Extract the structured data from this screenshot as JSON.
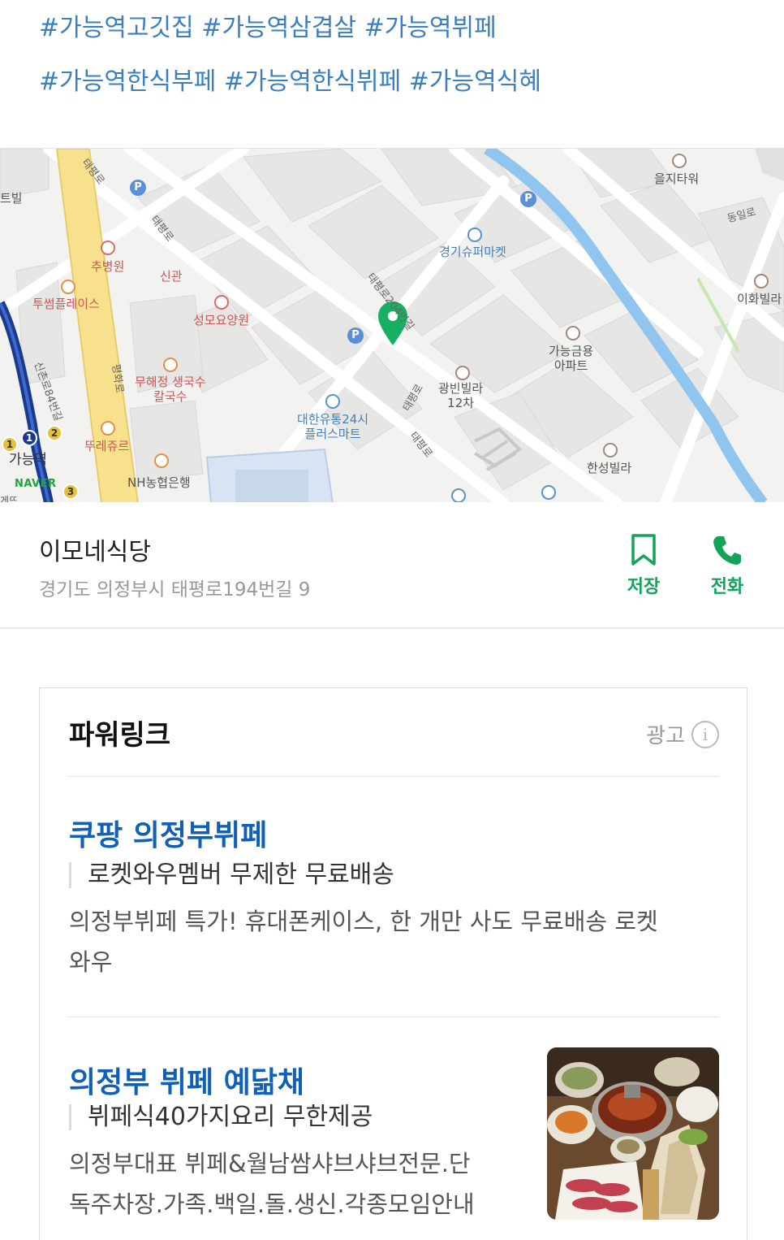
{
  "hashtags": {
    "line1": [
      "#가능역고깃집",
      "#가능역삼겹살",
      "#가능역뷔페"
    ],
    "line2": [
      "#가능역한식부페",
      "#가능역한식뷔페",
      "#가능역식혜"
    ]
  },
  "map": {
    "labels": {
      "euljitower": "을지타워",
      "dongilro": "동일로",
      "ihwavilla": "이화빌라",
      "gyeonggisuper": "경기슈퍼마켓",
      "gageumyong": "가능금용\n아파트",
      "gwangbinvilla": "광빈빌라\n12차",
      "hansungvilla": "한성빌라",
      "daehan24": "대한유통24시\n플러스마트",
      "taepyeong204": "태평로204번길",
      "taepyeongro_a": "태평로",
      "taepyeongro_b": "태평로",
      "taepyeongro_c": "태평로",
      "taepyeongro_d": "태평로",
      "chubyeongwon": "추병원",
      "singwan": "신관",
      "tusumplace": "투썸플레이스",
      "seongmo": "성모요양원",
      "pyeonghwaro": "평화로",
      "muhaejeong": "무해정 생국수\n칼국수",
      "ttorejure": "뚜레쥬르",
      "nhbank": "NH농협은행",
      "sinchonro": "신촌로84번길",
      "gaeungyeok": "가능역",
      "left_edge": "트빌",
      "left_bottom": "게뜨"
    },
    "subway_badges": [
      "1",
      "1",
      "2",
      "3"
    ],
    "brand": "NAVER",
    "colors": {
      "marker": "#17b060",
      "stream": "#8fc5ee",
      "main_road": "#f7e18c",
      "subway_line": "#1b3a8c"
    }
  },
  "place": {
    "name": "이모네식당",
    "address": "경기도 의정부시 태평로194번길 9",
    "save_label": "저장",
    "call_label": "전화"
  },
  "powerlink": {
    "title": "파워링크",
    "ad_label": "광고",
    "ads": [
      {
        "title": "쿠팡 의정부뷔페",
        "subtitle": "로켓와우멤버 무제한 무료배송",
        "desc_line1": "의정부뷔페 특가! 휴대폰케이스, 한 개만 사도 무료배송 로켓",
        "desc_line2": "와우"
      },
      {
        "title": "의정부 뷔페 예닮채",
        "subtitle": "뷔페식40가지요리 무한제공",
        "desc_line1": "의정부대표 뷔페&월남쌈샤브샤브전문.단",
        "desc_line2": "독주차장.가족.백일.돌.생신.각종모임안내"
      }
    ]
  }
}
